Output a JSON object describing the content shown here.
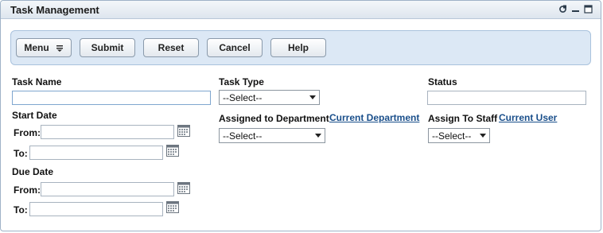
{
  "window": {
    "title": "Task Management"
  },
  "toolbar": {
    "menu_label": "Menu",
    "submit_label": "Submit",
    "reset_label": "Reset",
    "cancel_label": "Cancel",
    "help_label": "Help"
  },
  "form": {
    "task_name": {
      "label": "Task Name",
      "value": ""
    },
    "task_type": {
      "label": "Task Type",
      "selected": "--Select--"
    },
    "status": {
      "label": "Status",
      "value": ""
    },
    "start_date": {
      "label": "Start Date",
      "from_label": "From:",
      "to_label": "To:",
      "from_value": "",
      "to_value": ""
    },
    "due_date": {
      "label": "Due Date",
      "from_label": "From:",
      "to_label": "To:",
      "from_value": "",
      "to_value": ""
    },
    "department": {
      "label": "Assigned to Department",
      "link": "Current Department",
      "selected": "--Select--"
    },
    "staff": {
      "label": "Assign To Staff",
      "link": "Current User",
      "selected": "--Select--"
    }
  }
}
